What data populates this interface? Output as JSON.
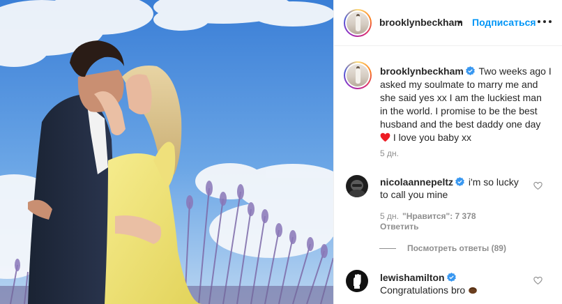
{
  "post": {
    "username": "brooklynbeckham",
    "dot": "•",
    "follow_label": "Подписаться",
    "more_icon": "more-horizontal-icon"
  },
  "caption": {
    "username": "brooklynbeckham",
    "text_part1": "Two weeks ago I asked my soulmate to marry me and she said yes xx I am the luckiest man in the world. I promise to be the best husband and the best daddy one day",
    "text_part2": "I love you baby xx",
    "time": "5 дн."
  },
  "comments": [
    {
      "username": "nicolaannepeltz",
      "text": "i'm so lucky to call you mine",
      "time": "5 дн.",
      "likes_label": "\"Нравится\": 7 378",
      "reply_label": "Ответить",
      "view_replies": "Посмотреть ответы (89)"
    },
    {
      "username": "lewishamilton",
      "text": "Congratulations bro"
    }
  ],
  "colors": {
    "link": "#0095f6",
    "verified": "#3897f0",
    "muted": "#8e8e8e",
    "heart_emoji": "#ed1c24"
  }
}
